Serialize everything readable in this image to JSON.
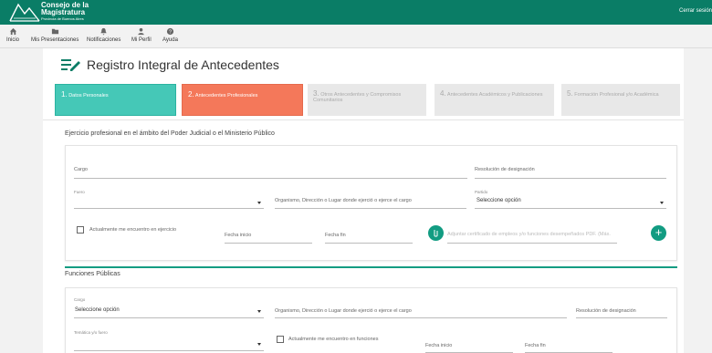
{
  "header": {
    "logo_title_line1": "Consejo de la",
    "logo_title_line2": "Magistratura",
    "logo_subtitle": "Provincia de Buenos Aires",
    "logout_label": "Cerrar sesión",
    "bg_color": "#0a7d66"
  },
  "nav": {
    "items": [
      {
        "label": "Inicio",
        "icon": "home-icon"
      },
      {
        "label": "Mis Presentaciones",
        "icon": "folder-icon"
      },
      {
        "label": "Notificaciones",
        "icon": "bell-icon"
      },
      {
        "label": "Mi Perfil",
        "icon": "user-icon"
      },
      {
        "label": "Ayuda",
        "icon": "help-icon"
      }
    ]
  },
  "page": {
    "title": "Registro Integral de Antecedentes"
  },
  "steps": [
    {
      "num": "1.",
      "label": "Datos Personales",
      "state": "done",
      "color": "#45c8b7"
    },
    {
      "num": "2.",
      "label": "Antecedentes Profesionales",
      "state": "current",
      "color": "#f4785a"
    },
    {
      "num": "3.",
      "label": "Otros Antecedentes y Compromisos Comunitarios",
      "state": "pending"
    },
    {
      "num": "4.",
      "label": "Antecedentes Académicos y Publicaciones",
      "state": "pending"
    },
    {
      "num": "5.",
      "label": "Formación Profesional y/o Académica",
      "state": "pending"
    }
  ],
  "section1": {
    "title": "Ejercicio profesional en el ámbito del Poder Judicial o el Ministerio Público",
    "cargo_label": "Cargo",
    "resolucion_label": "Resolución de designación",
    "fuero_label": "Fuero",
    "organismo_label": "Organismo, Dirección o Lugar donde ejerció o ejerce el cargo",
    "partido_label": "Partido",
    "partido_value": "Seleccione opción",
    "actualmente_label": "Actualmente me encuentro en ejercicio",
    "fecha_inicio_label": "Fecha inicio",
    "fecha_fin_label": "Fecha fin",
    "adjuntar_label": "Adjuntar certificado de empleos y/o funciones desempeñados PDF. (Máx.",
    "add_label": "+"
  },
  "section2": {
    "title": "Funciones Públicas",
    "cargo_label": "Cargo",
    "cargo_value": "Seleccione opción",
    "organismo_label": "Organismo, Dirección o Lugar donde ejerció o ejerce el cargo",
    "resolucion_label": "Resolución de designación",
    "tematica_label": "Temática y/o fuero",
    "actualmente_label": "Actualmente me encuentro en funciones",
    "fecha_inicio_label": "Fecha inicio",
    "fecha_fin_label": "Fecha fin"
  },
  "colors": {
    "accent": "#129c82",
    "step_done": "#45c8b7",
    "step_current": "#f4785a"
  }
}
